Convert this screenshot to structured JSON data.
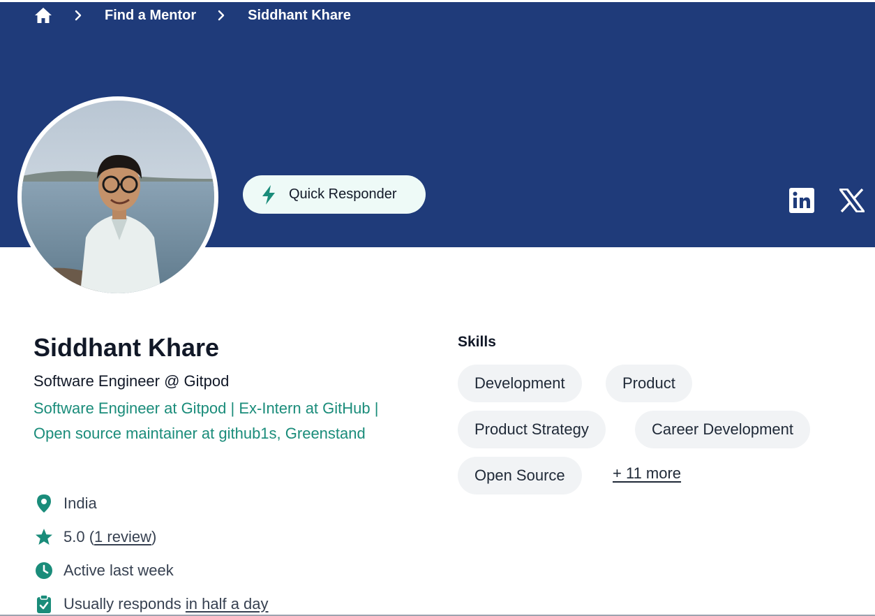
{
  "breadcrumb": {
    "home_icon": "home-icon",
    "items": [
      "Find a Mentor",
      "Siddhant Khare"
    ]
  },
  "badge": {
    "label": "Quick Responder",
    "icon": "bolt-icon",
    "icon_color": "#1a8c7a"
  },
  "social": {
    "linkedin_icon": "linkedin-icon",
    "x_icon": "x-icon"
  },
  "colors": {
    "banner": "#1f3b7a",
    "accent": "#1a8c7a",
    "chip_bg": "#f1f3f5"
  },
  "profile": {
    "name": "Siddhant Khare",
    "headline": "Software Engineer @ Gitpod",
    "bio": "Software Engineer at Gitpod | Ex-Intern at GitHub | Open source maintainer at github1s, Greenstand",
    "location": "India",
    "rating": "5.0",
    "reviews_link": "1 review",
    "activity": "Active last week",
    "response_prefix": "Usually responds ",
    "response_time": "in half a day"
  },
  "skills": {
    "title": "Skills",
    "items": [
      "Development",
      "Product",
      "Product Strategy",
      "Career Development",
      "Open Source"
    ],
    "more_link": "+ 11 more"
  }
}
